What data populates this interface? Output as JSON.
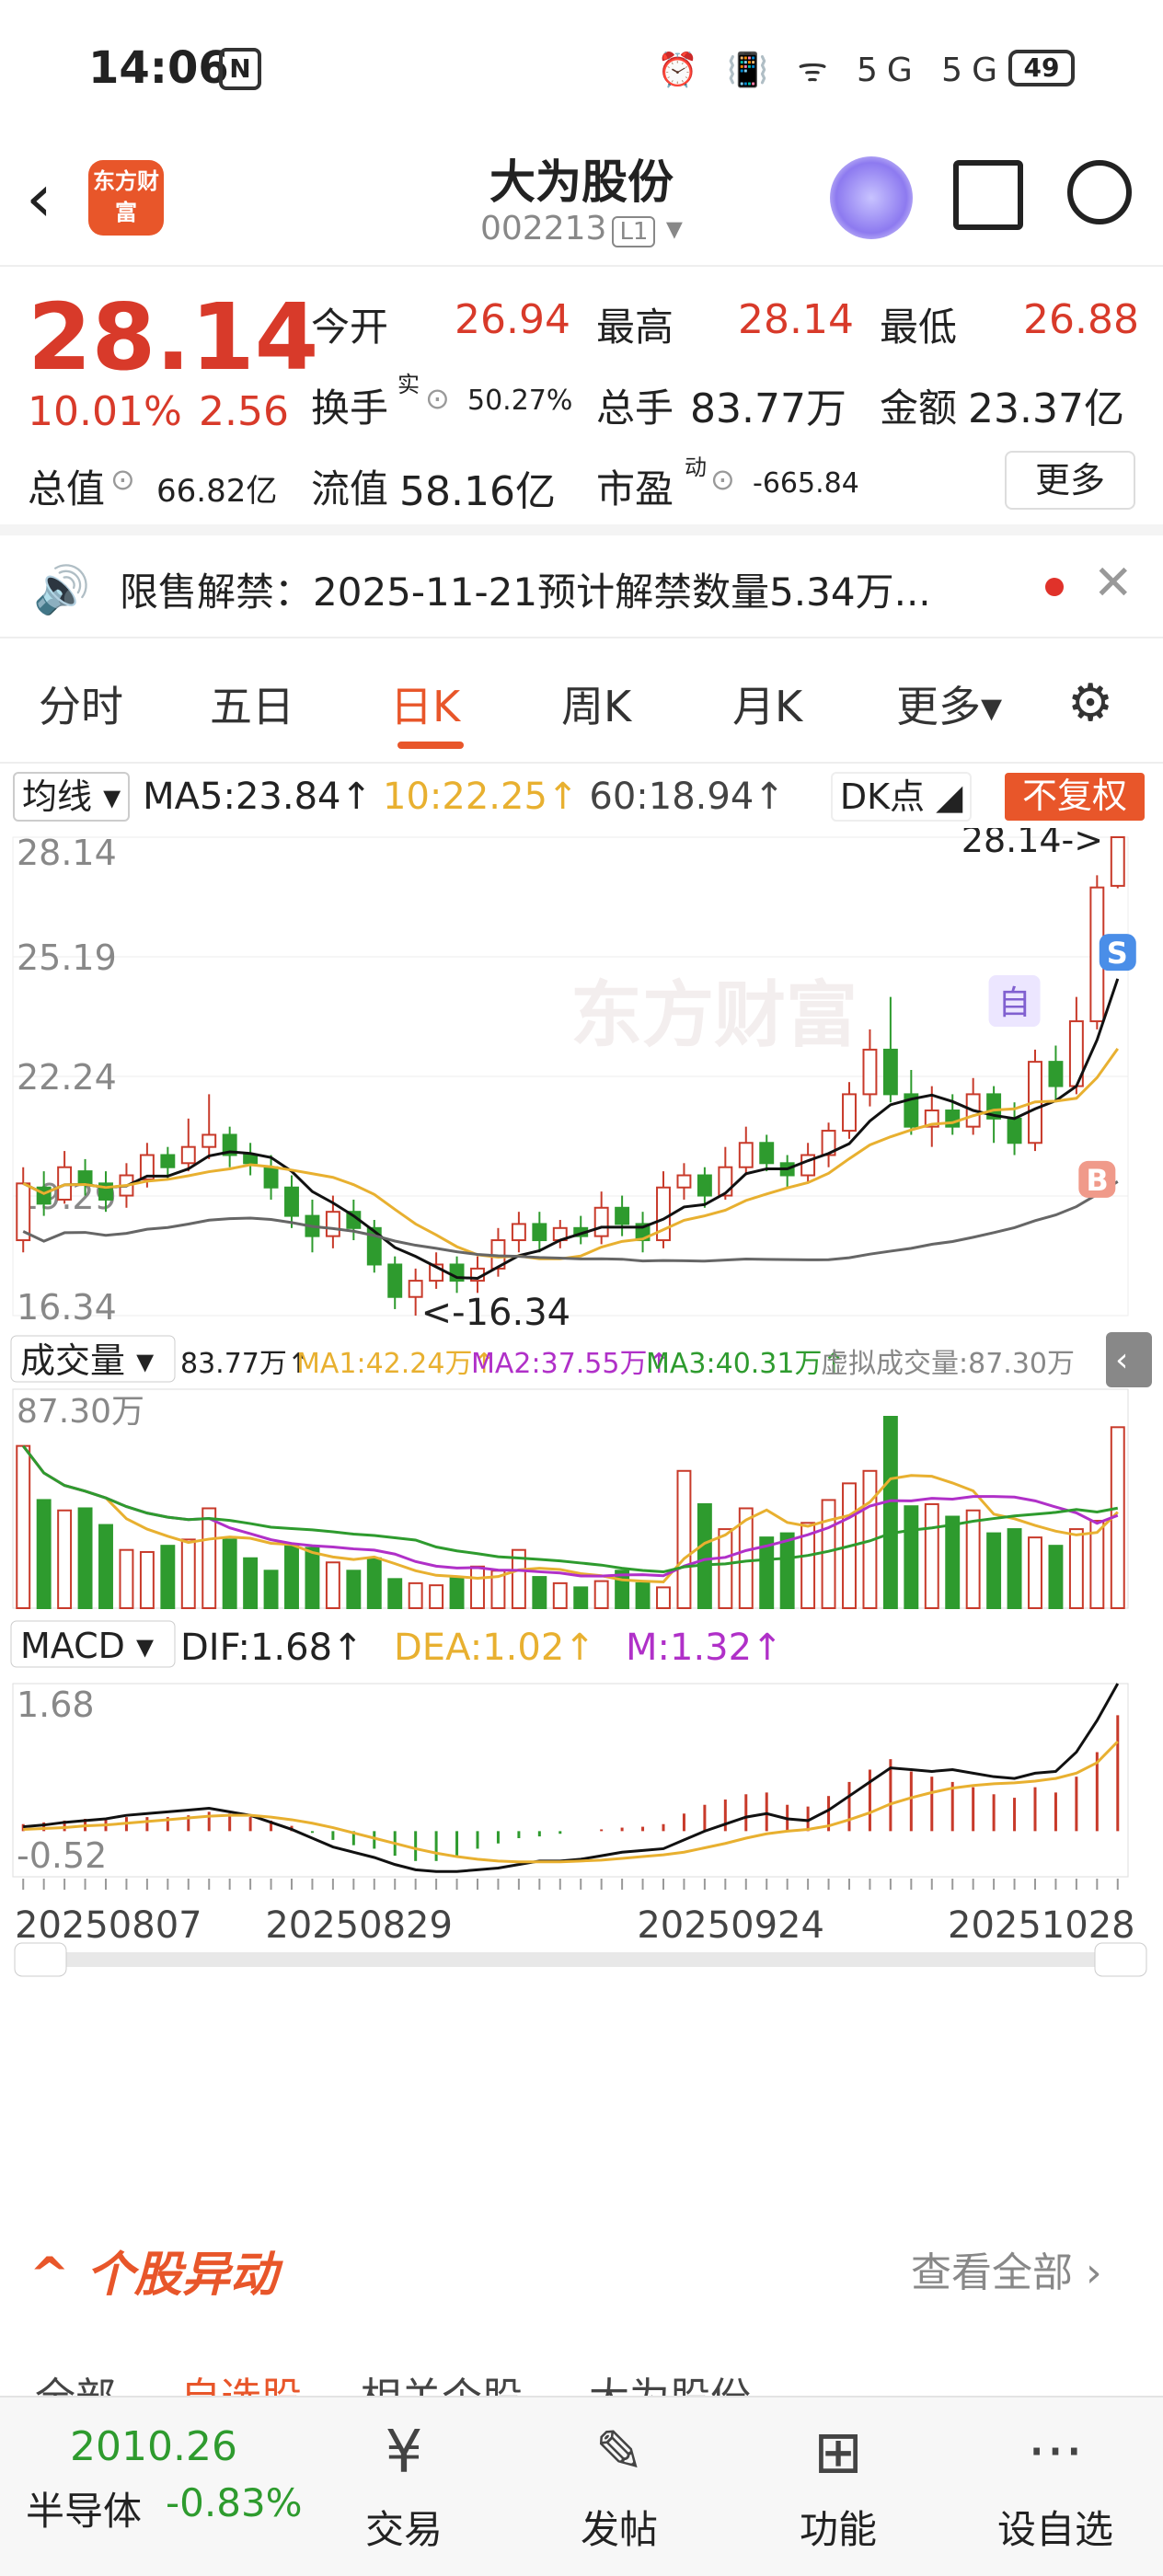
{
  "status_bar": {
    "time": "14:06",
    "nfc": "N",
    "icons": "⏰ 📳 ᯤ 5G 5G",
    "battery": "49"
  },
  "header": {
    "logo_text": "东方财富",
    "name": "大为股份",
    "code": "002213",
    "level": "L1"
  },
  "quote": {
    "price": "28.14",
    "change_pct": "10.01%",
    "change": "2.56",
    "open_label": "今开",
    "open": "26.94",
    "high_label": "最高",
    "high": "28.14",
    "low_label": "最低",
    "low": "26.88",
    "turnover_label": "换手",
    "turnover_sup": "实",
    "turnover": "50.27%",
    "volume_label": "总手",
    "volume": "83.77万",
    "amount_label": "金额",
    "amount": "23.37亿",
    "mcap_label": "总值",
    "mcap": "66.82亿",
    "float_label": "流值",
    "float": "58.16亿",
    "pe_label": "市盈",
    "pe_sup": "动",
    "pe": "-665.84",
    "more": "更多"
  },
  "notice": {
    "text": "限售解禁：2025-11-21预计解禁数量5.34万..."
  },
  "tabs": [
    "分时",
    "五日",
    "日K",
    "周K",
    "月K",
    "更多▾"
  ],
  "active_tab": "日K",
  "ma_bar": {
    "selector": "均线",
    "ma5": "MA5:23.84↑",
    "ma10": "10:22.25↑",
    "ma60": "60:18.94↑",
    "dk": "DK点",
    "fuquan": "不复权"
  },
  "vol_bar": {
    "selector": "成交量",
    "v": "83.77万↑",
    "ma1": "MA1:42.24万↑",
    "ma2": "MA2:37.55万↑",
    "ma3": "MA3:40.31万↑",
    "virtual": "虚拟成交量:87.30万",
    "max": "87.30万"
  },
  "macd_bar": {
    "selector": "MACD",
    "dif": "DIF:1.68↑",
    "dea": "DEA:1.02↑",
    "m": "M:1.32↑",
    "top": "1.68",
    "bottom": "-0.52"
  },
  "chart_data": {
    "type": "candlestick",
    "y_ticks": [
      "28.14",
      "25.19",
      "22.24",
      "19.29",
      "16.34"
    ],
    "ylim": [
      16.34,
      28.14
    ],
    "high_note": "28.14->",
    "low_note": "<-16.34",
    "dates": [
      "20250807",
      "20250829",
      "20250924",
      "20251028"
    ],
    "markers": {
      "self": "自",
      "sell": "S",
      "buy": "B"
    },
    "candles": [
      [
        18.2,
        19.6,
        20.0,
        17.9
      ],
      [
        19.5,
        19.1,
        19.9,
        18.8
      ],
      [
        19.2,
        20.0,
        20.4,
        19.1
      ],
      [
        19.9,
        19.6,
        20.2,
        19.3
      ],
      [
        19.6,
        19.2,
        19.9,
        18.9
      ],
      [
        19.3,
        19.8,
        20.1,
        19.0
      ],
      [
        19.7,
        20.3,
        20.6,
        19.5
      ],
      [
        20.3,
        20.0,
        20.5,
        19.7
      ],
      [
        20.1,
        20.5,
        21.2,
        19.9
      ],
      [
        20.5,
        20.8,
        21.8,
        20.2
      ],
      [
        20.8,
        20.3,
        21.0,
        20.0
      ],
      [
        20.3,
        20.1,
        20.6,
        19.8
      ],
      [
        20.0,
        19.5,
        20.3,
        19.2
      ],
      [
        19.5,
        18.8,
        19.8,
        18.5
      ],
      [
        18.8,
        18.3,
        19.2,
        17.9
      ],
      [
        18.3,
        18.9,
        19.3,
        18.0
      ],
      [
        18.9,
        18.5,
        19.2,
        18.2
      ],
      [
        18.5,
        17.6,
        18.7,
        17.4
      ],
      [
        17.6,
        16.8,
        17.8,
        16.5
      ],
      [
        16.8,
        17.2,
        17.5,
        16.34
      ],
      [
        17.2,
        17.6,
        17.9,
        17.0
      ],
      [
        17.6,
        17.2,
        17.8,
        16.9
      ],
      [
        17.2,
        17.5,
        17.8,
        16.9
      ],
      [
        17.5,
        18.2,
        18.5,
        17.3
      ],
      [
        18.2,
        18.6,
        18.9,
        17.9
      ],
      [
        18.6,
        18.2,
        18.9,
        17.9
      ],
      [
        18.2,
        18.5,
        18.7,
        18.0
      ],
      [
        18.5,
        18.3,
        18.8,
        18.1
      ],
      [
        18.3,
        19.0,
        19.4,
        18.1
      ],
      [
        19.0,
        18.6,
        19.3,
        18.3
      ],
      [
        18.6,
        18.2,
        18.9,
        17.9
      ],
      [
        18.2,
        19.5,
        19.9,
        18.0
      ],
      [
        19.5,
        19.8,
        20.1,
        19.2
      ],
      [
        19.8,
        19.3,
        20.0,
        19.0
      ],
      [
        19.3,
        20.0,
        20.5,
        19.2
      ],
      [
        20.0,
        20.6,
        21.0,
        19.8
      ],
      [
        20.6,
        20.1,
        20.8,
        19.9
      ],
      [
        20.1,
        19.8,
        20.3,
        19.5
      ],
      [
        19.8,
        20.3,
        20.6,
        19.6
      ],
      [
        20.3,
        20.9,
        21.1,
        20.0
      ],
      [
        20.9,
        21.8,
        22.1,
        20.7
      ],
      [
        21.8,
        22.9,
        23.4,
        21.5
      ],
      [
        22.9,
        21.8,
        24.2,
        21.6
      ],
      [
        21.8,
        21.0,
        22.4,
        20.8
      ],
      [
        21.0,
        21.4,
        22.0,
        20.5
      ],
      [
        21.4,
        21.0,
        21.8,
        20.8
      ],
      [
        21.0,
        21.8,
        22.2,
        20.8
      ],
      [
        21.8,
        21.2,
        22.0,
        20.6
      ],
      [
        21.2,
        20.6,
        21.6,
        20.3
      ],
      [
        20.6,
        22.6,
        22.9,
        20.4
      ],
      [
        22.6,
        22.0,
        23.0,
        21.6
      ],
      [
        22.0,
        23.6,
        24.2,
        21.8
      ],
      [
        23.6,
        26.9,
        27.2,
        23.4
      ],
      [
        26.94,
        28.14,
        28.14,
        26.88
      ]
    ],
    "volume": [
      78,
      52,
      47,
      48,
      40,
      28,
      27,
      30,
      33,
      48,
      33,
      24,
      18,
      30,
      29,
      22,
      18,
      24,
      14,
      12,
      11,
      15,
      20,
      18,
      28,
      15,
      12,
      10,
      13,
      18,
      12,
      10,
      66,
      50,
      38,
      48,
      34,
      36,
      41,
      52,
      60,
      66,
      92,
      49,
      50,
      44,
      47,
      36,
      38,
      34,
      30,
      38,
      42,
      87
    ],
    "macd_bar": [
      0.08,
      0.1,
      0.12,
      0.14,
      0.14,
      0.16,
      0.16,
      0.16,
      0.18,
      0.22,
      0.2,
      0.16,
      0.12,
      0.06,
      -0.02,
      -0.1,
      -0.16,
      -0.2,
      -0.28,
      -0.34,
      -0.34,
      -0.28,
      -0.2,
      -0.14,
      -0.08,
      -0.06,
      -0.03,
      0.0,
      0.02,
      0.04,
      0.05,
      0.08,
      0.2,
      0.3,
      0.36,
      0.42,
      0.44,
      0.3,
      0.28,
      0.4,
      0.56,
      0.7,
      0.82,
      0.68,
      0.62,
      0.56,
      0.5,
      0.42,
      0.38,
      0.5,
      0.44,
      0.62,
      0.9,
      1.32
    ],
    "dif": [
      0.05,
      0.07,
      0.1,
      0.12,
      0.14,
      0.18,
      0.2,
      0.22,
      0.24,
      0.26,
      0.22,
      0.18,
      0.1,
      0.02,
      -0.08,
      -0.18,
      -0.24,
      -0.3,
      -0.38,
      -0.44,
      -0.46,
      -0.46,
      -0.44,
      -0.42,
      -0.38,
      -0.34,
      -0.34,
      -0.32,
      -0.28,
      -0.24,
      -0.22,
      -0.2,
      -0.1,
      0.0,
      0.08,
      0.16,
      0.2,
      0.14,
      0.12,
      0.24,
      0.4,
      0.56,
      0.72,
      0.7,
      0.68,
      0.7,
      0.66,
      0.62,
      0.6,
      0.66,
      0.68,
      0.9,
      1.26,
      1.68
    ],
    "dea": [
      0.02,
      0.03,
      0.04,
      0.06,
      0.07,
      0.09,
      0.11,
      0.13,
      0.15,
      0.17,
      0.18,
      0.18,
      0.16,
      0.13,
      0.09,
      0.04,
      -0.02,
      -0.08,
      -0.14,
      -0.2,
      -0.25,
      -0.29,
      -0.32,
      -0.34,
      -0.35,
      -0.35,
      -0.35,
      -0.34,
      -0.33,
      -0.31,
      -0.29,
      -0.27,
      -0.24,
      -0.19,
      -0.14,
      -0.08,
      -0.03,
      0.0,
      0.02,
      0.06,
      0.13,
      0.21,
      0.31,
      0.38,
      0.44,
      0.49,
      0.52,
      0.54,
      0.55,
      0.57,
      0.6,
      0.66,
      0.78,
      1.02
    ]
  },
  "section": {
    "title": "个股异动",
    "view_all": "查看全部"
  },
  "subtabs": [
    "全部",
    "自选股",
    "相关个股",
    "大为股份"
  ],
  "bottom_bar": {
    "index_value": "2010.26",
    "index_name": "半导体",
    "index_change": "-0.83%",
    "items": [
      {
        "label": "交易",
        "icon": "¥"
      },
      {
        "label": "发帖",
        "icon": "✎"
      },
      {
        "label": "功能",
        "icon": "⊞"
      },
      {
        "label": "设自选",
        "icon": "···"
      }
    ]
  }
}
